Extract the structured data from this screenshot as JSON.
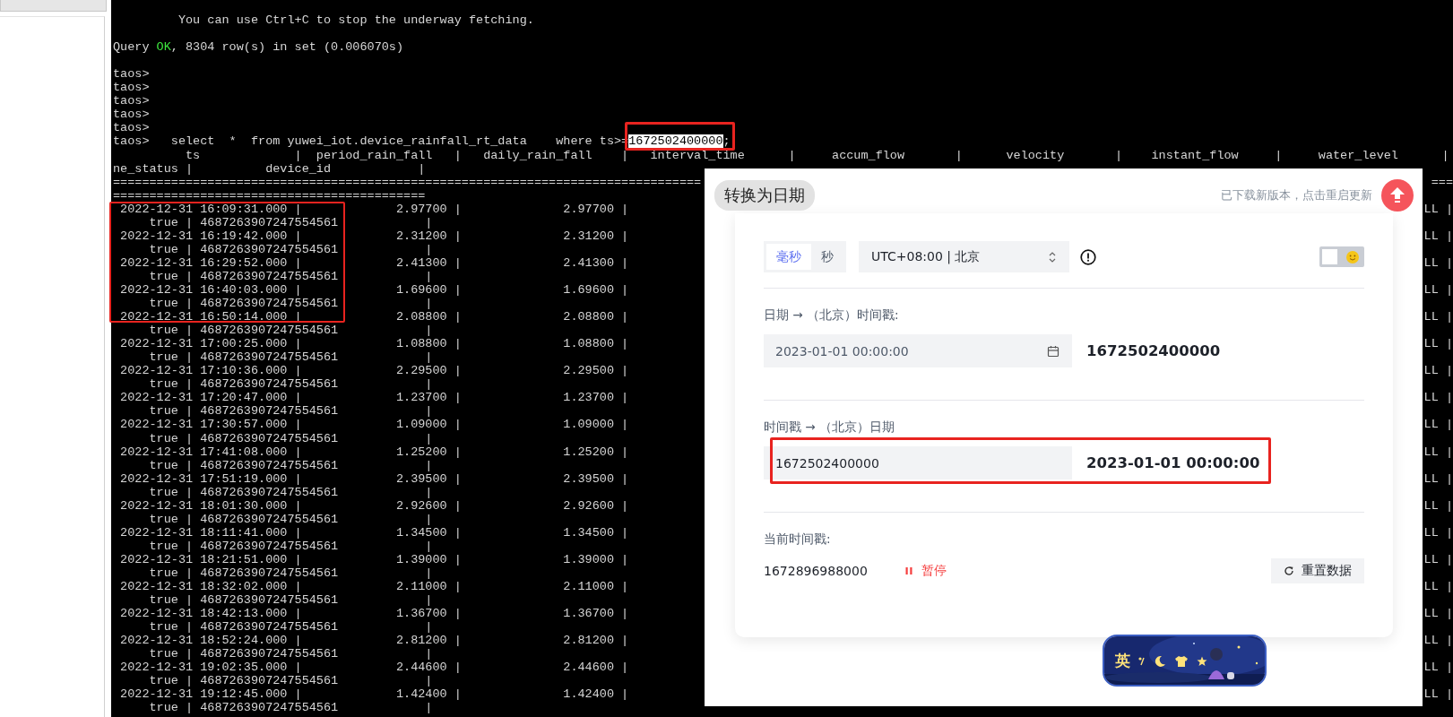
{
  "terminal": {
    "lines": [
      {
        "kind": "blank"
      },
      {
        "kind": "plain",
        "text": "         You can use Ctrl+C to stop the underway fetching."
      },
      {
        "kind": "blank"
      },
      {
        "kind": "mixed",
        "parts": [
          {
            "text": "Query ",
            "kind": "plain"
          },
          {
            "text": "OK",
            "kind": "ok"
          },
          {
            "text": ", 8304 row(s) in set (0.006070s)",
            "kind": "plain"
          }
        ]
      },
      {
        "kind": "blank"
      },
      {
        "kind": "plain",
        "text": "taos>"
      },
      {
        "kind": "plain",
        "text": "taos>"
      },
      {
        "kind": "plain",
        "text": "taos>"
      },
      {
        "kind": "plain",
        "text": "taos>"
      },
      {
        "kind": "plain",
        "text": "taos>"
      },
      {
        "kind": "mixed",
        "parts": [
          {
            "text": "taos>   select  *  from yuwei_iot.device_rainfall_rt_data    where ts>=",
            "kind": "plain"
          },
          {
            "text": "1672502400000",
            "kind": "selected"
          },
          {
            "text": ";",
            "kind": "plain"
          }
        ]
      },
      {
        "kind": "plain",
        "text": "          ts             |  period_rain_fall   |   daily_rain_fall    |   interval_time      |     accum_flow       |      velocity       |    instant_flow     |     water_level      |"
      },
      {
        "kind": "plain",
        "text": "ne_status |          device_id            |"
      },
      {
        "kind": "plain",
        "text": "=================================================================================",
        "right": "==="
      },
      {
        "kind": "plain",
        "text": "==========================================="
      },
      {
        "kind": "plain",
        "text": " 2022-12-31 16:09:31.000 |             2.97700 |              2.97700 |",
        "right": "LL |"
      },
      {
        "kind": "plain",
        "text": "     true | 4687263907247554561            |"
      },
      {
        "kind": "plain",
        "text": " 2022-12-31 16:19:42.000 |             2.31200 |              2.31200 |",
        "right": "LL |"
      },
      {
        "kind": "plain",
        "text": "     true | 4687263907247554561            |"
      },
      {
        "kind": "plain",
        "text": " 2022-12-31 16:29:52.000 |             2.41300 |              2.41300 |",
        "right": "LL |"
      },
      {
        "kind": "plain",
        "text": "     true | 4687263907247554561            |"
      },
      {
        "kind": "plain",
        "text": " 2022-12-31 16:40:03.000 |             1.69600 |              1.69600 |",
        "right": "LL |"
      },
      {
        "kind": "plain",
        "text": "     true | 4687263907247554561            |"
      },
      {
        "kind": "plain",
        "text": " 2022-12-31 16:50:14.000 |             2.08800 |              2.08800 |",
        "right": "LL |"
      },
      {
        "kind": "plain",
        "text": "     true | 4687263907247554561            |"
      },
      {
        "kind": "plain",
        "text": " 2022-12-31 17:00:25.000 |             1.08800 |              1.08800 |",
        "right": "LL |"
      },
      {
        "kind": "plain",
        "text": "     true | 4687263907247554561            |"
      },
      {
        "kind": "plain",
        "text": " 2022-12-31 17:10:36.000 |             2.29500 |              2.29500 |",
        "right": "LL |"
      },
      {
        "kind": "plain",
        "text": "     true | 4687263907247554561            |"
      },
      {
        "kind": "plain",
        "text": " 2022-12-31 17:20:47.000 |             1.23700 |              1.23700 |",
        "right": "LL |"
      },
      {
        "kind": "plain",
        "text": "     true | 4687263907247554561            |"
      },
      {
        "kind": "plain",
        "text": " 2022-12-31 17:30:57.000 |             1.09000 |              1.09000 |",
        "right": "LL |"
      },
      {
        "kind": "plain",
        "text": "     true | 4687263907247554561            |"
      },
      {
        "kind": "plain",
        "text": " 2022-12-31 17:41:08.000 |             1.25200 |              1.25200 |",
        "right": "LL |"
      },
      {
        "kind": "plain",
        "text": "     true | 4687263907247554561            |"
      },
      {
        "kind": "plain",
        "text": " 2022-12-31 17:51:19.000 |             2.39500 |              2.39500 |",
        "right": "LL |"
      },
      {
        "kind": "plain",
        "text": "     true | 4687263907247554561            |"
      },
      {
        "kind": "plain",
        "text": " 2022-12-31 18:01:30.000 |             2.92600 |              2.92600 |",
        "right": "LL |"
      },
      {
        "kind": "plain",
        "text": "     true | 4687263907247554561            |"
      },
      {
        "kind": "plain",
        "text": " 2022-12-31 18:11:41.000 |             1.34500 |              1.34500 |",
        "right": "LL |"
      },
      {
        "kind": "plain",
        "text": "     true | 4687263907247554561            |"
      },
      {
        "kind": "plain",
        "text": " 2022-12-31 18:21:51.000 |             1.39000 |              1.39000 |",
        "right": "LL |"
      },
      {
        "kind": "plain",
        "text": "     true | 4687263907247554561            |"
      },
      {
        "kind": "plain",
        "text": " 2022-12-31 18:32:02.000 |             2.11000 |              2.11000 |",
        "right": "LL |"
      },
      {
        "kind": "plain",
        "text": "     true | 4687263907247554561            |"
      },
      {
        "kind": "plain",
        "text": " 2022-12-31 18:42:13.000 |             1.36700 |              1.36700 |",
        "right": "LL |"
      },
      {
        "kind": "plain",
        "text": "     true | 4687263907247554561            |"
      },
      {
        "kind": "plain",
        "text": " 2022-12-31 18:52:24.000 |             2.81200 |              2.81200 |",
        "right": "LL |"
      },
      {
        "kind": "plain",
        "text": "     true | 4687263907247554561            |"
      },
      {
        "kind": "plain",
        "text": " 2022-12-31 19:02:35.000 |             2.44600 |              2.44600 |",
        "right": "LL |"
      },
      {
        "kind": "plain",
        "text": "     true | 4687263907247554561            |"
      },
      {
        "kind": "plain",
        "text": " 2022-12-31 19:12:45.000 |             1.42400 |              1.42400 |",
        "right": "LL |"
      },
      {
        "kind": "plain",
        "text": "     true | 4687263907247554561            |"
      }
    ]
  },
  "converter": {
    "title": "转换为日期",
    "update_notice": "已下载新版本，点击重启更新",
    "units": [
      {
        "label": "毫秒",
        "selected": true
      },
      {
        "label": "秒",
        "selected": false
      }
    ],
    "timezone": "UTC+08:00 | 北京",
    "theme_toggle": {
      "on": false
    },
    "date_to_ts": {
      "label": "日期 → （北京）时间戳:",
      "value": "2023-01-01 00:00:00",
      "result": "1672502400000"
    },
    "ts_to_date": {
      "label": "时间戳 → （北京）日期",
      "value": "1672502400000",
      "result": "2023-01-01 00:00:00"
    },
    "current": {
      "label": "当前时间戳:",
      "value": "1672896988000",
      "pause_button": "暂停",
      "reset_button": "重置数据"
    }
  },
  "ime_bar": {
    "mode": "英"
  }
}
